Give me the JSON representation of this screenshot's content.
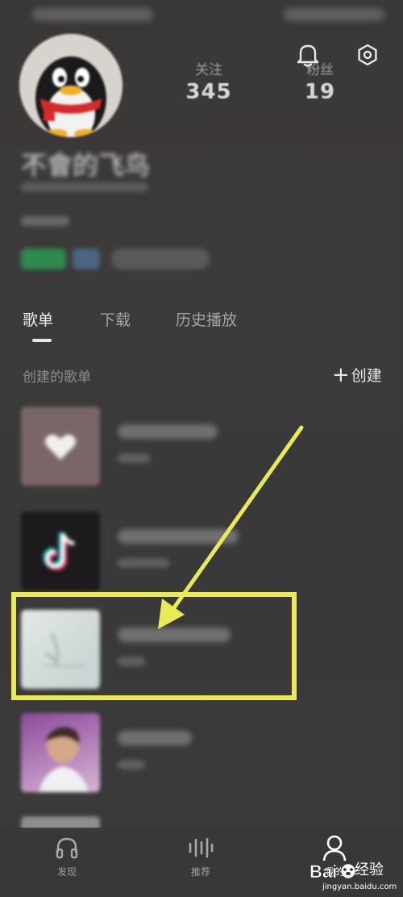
{
  "profile": {
    "username": "不會的飞鸟",
    "follow_label": "关注",
    "follow_count": "345",
    "fans_label": "粉丝",
    "fans_count": "19"
  },
  "tabs": [
    {
      "label": "歌单",
      "active": true
    },
    {
      "label": "下载",
      "active": false
    },
    {
      "label": "历史播放",
      "active": false
    }
  ],
  "section": {
    "title": "创建的歌单",
    "create_label": "创建",
    "create_icon": "plus-icon"
  },
  "bottom_nav": [
    {
      "label": "发现",
      "icon": "headphones-icon"
    },
    {
      "label": "推荐",
      "icon": "equalizer-icon"
    },
    {
      "label": "我的",
      "icon": "user-icon"
    }
  ],
  "watermark": {
    "brand": "Bai",
    "brand_suffix": "经验",
    "site": "jingyan.baidu.com"
  },
  "colors": {
    "background": "#3b3b3b",
    "highlight": "#e9ea55",
    "accent_green": "#2e8a4d"
  }
}
